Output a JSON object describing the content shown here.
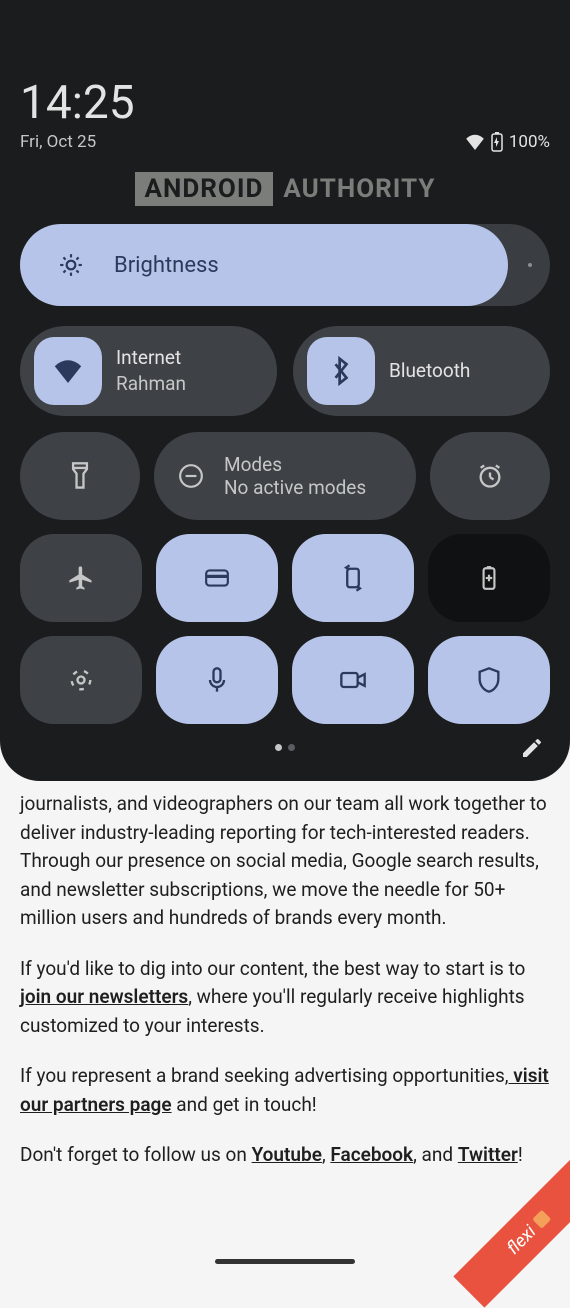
{
  "status": {
    "time": "14:25",
    "date": "Fri, Oct 25",
    "battery": "100%"
  },
  "watermark": {
    "a": "ANDROID",
    "b": "AUTHORITY"
  },
  "brightness": {
    "label": "Brightness"
  },
  "tiles": {
    "internet": {
      "title": "Internet",
      "sub": "Rahman"
    },
    "bluetooth": {
      "title": "Bluetooth"
    },
    "modes": {
      "title": "Modes",
      "sub": "No active modes"
    }
  },
  "article": {
    "p1": "journalists, and videographers on our team all work together to deliver industry-leading reporting for tech-interested readers. Through our presence on social media, Google search results, and newsletter subscriptions, we move the needle for 50+ million users and hundreds of brands every month.",
    "p2a": "If you'd like to dig into our content, the best way to start is to ",
    "p2link": "join our newsletters",
    "p2b": ", where you'll regularly receive highlights customized to your interests.",
    "p3a": "If you represent a brand seeking advertising opportunities,",
    "p3link": " visit our partners page",
    "p3b": " and get in touch!",
    "p4a": "Don't forget to follow us on ",
    "p4l1": "Youtube",
    "p4s1": ", ",
    "p4l2": "Facebook",
    "p4s2": ", and ",
    "p4l3": "Twitter",
    "p4s3": "!"
  },
  "flexi": "flexi"
}
